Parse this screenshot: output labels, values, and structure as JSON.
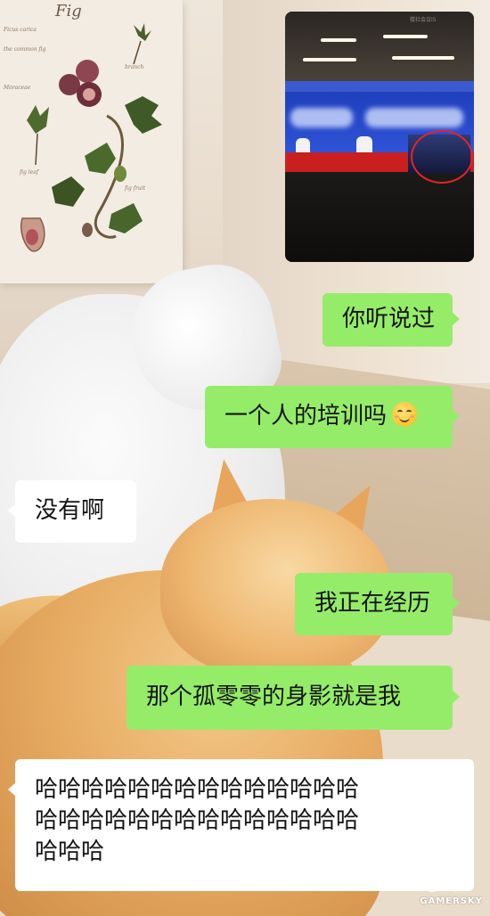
{
  "screenshot": {
    "caption": "楼社会议I5"
  },
  "poster": {
    "title": "Fig",
    "script_lines": [
      "Ficus carica",
      "the common fig",
      "Moraceae",
      "fig leaf",
      "fig fruit",
      "branch"
    ]
  },
  "messages": [
    {
      "side": "right",
      "text": "你听说过"
    },
    {
      "side": "right",
      "text": "一个人的培训吗",
      "emoji": "smiling-face-emoji"
    },
    {
      "side": "left",
      "text": "没有啊"
    },
    {
      "side": "right",
      "text": "我正在经历"
    },
    {
      "side": "right",
      "text": "那个孤零零的身影就是我"
    },
    {
      "side": "left",
      "lines": [
        "哈哈哈哈哈哈哈哈哈哈哈哈哈哈",
        "哈哈哈哈哈哈哈哈哈哈哈哈哈哈",
        "哈哈哈"
      ]
    }
  ],
  "watermark": {
    "char": "史",
    "text": "GAMERSKY"
  },
  "colors": {
    "outgoing_bubble": "#95ec69",
    "incoming_bubble": "#ffffff",
    "highlight_circle": "#e2242c",
    "stage_blue": "#2f55d8",
    "table_red": "#c91f1f"
  }
}
